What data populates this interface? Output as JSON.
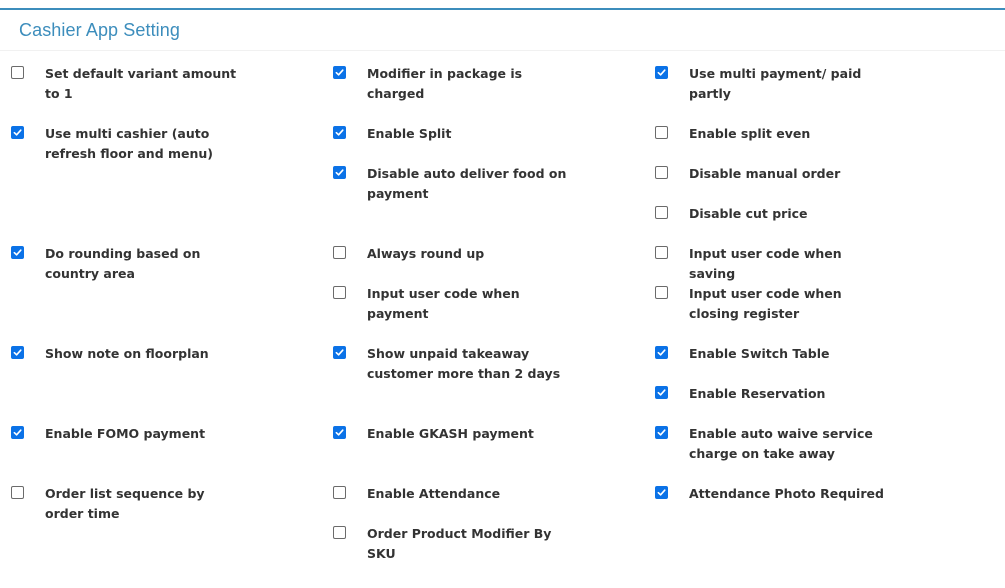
{
  "panel": {
    "title": "Cashier App Setting"
  },
  "columns": [
    [
      {
        "label": "Set default variant amount to 1",
        "checked": false
      },
      {
        "label": "Use multi cashier (auto refresh floor and menu)",
        "checked": true
      },
      {
        "label": "Do rounding based on country area",
        "checked": true
      },
      {
        "label": "Show note on floorplan",
        "checked": true
      },
      {
        "label": "Enable FOMO payment",
        "checked": true
      },
      {
        "label": "Order list sequence by order time",
        "checked": false
      }
    ],
    [
      {
        "label": "Modifier in package is charged",
        "checked": true
      },
      {
        "label": "Enable Split",
        "checked": true
      },
      {
        "label": "Disable auto deliver food on payment",
        "checked": true
      },
      {
        "label": "Always round up",
        "checked": false
      },
      {
        "label": "Input user code when payment",
        "checked": false
      },
      {
        "label": "Show unpaid takeaway customer more than 2 days",
        "checked": true
      },
      {
        "label": "Enable GKASH payment",
        "checked": true
      },
      {
        "label": "Enable Attendance",
        "checked": false
      },
      {
        "label": "Order Product Modifier By SKU",
        "checked": false
      }
    ],
    [
      {
        "label": "Use multi payment/ paid partly",
        "checked": true
      },
      {
        "label": "Enable split even",
        "checked": false
      },
      {
        "label": "Disable manual order",
        "checked": false
      },
      {
        "label": "Disable cut price",
        "checked": false
      },
      {
        "label": "Input user code when saving",
        "checked": false
      },
      {
        "label": "Input user code when closing register",
        "checked": false
      },
      {
        "label": "Enable Switch Table",
        "checked": true
      },
      {
        "label": "Enable Reservation",
        "checked": true
      },
      {
        "label": "Enable auto waive service charge on take away",
        "checked": true
      },
      {
        "label": "Attendance Photo Required",
        "checked": true
      }
    ]
  ]
}
